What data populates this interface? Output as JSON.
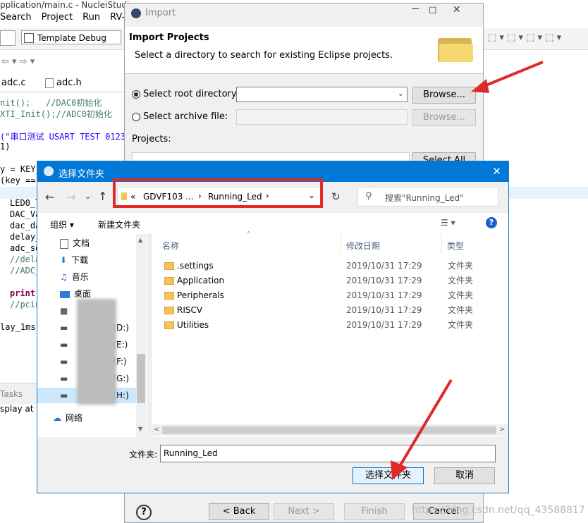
{
  "ide": {
    "title": "pplication/main.c - NucleiStudio",
    "menu": [
      "Search",
      "Project",
      "Run",
      "RV-T"
    ],
    "launch_config": "Template Debug",
    "tabs": [
      "adc.c",
      "adc.h"
    ],
    "code_lines": [
      {
        "t": "nit();   //DAC0初始化"
      },
      {
        "t": "XTI_Init();//ADC0初始化"
      },
      {
        "t": "(\"串口测试 USART TEST 01234"
      },
      {
        "t": "1)"
      },
      {
        "t": "y = KEY_"
      },
      {
        "t": "(key =="
      },
      {
        "t": "LED0_T"
      },
      {
        "t": "DAC_Va"
      },
      {
        "t": "dac_da"
      },
      {
        "t": "delay_"
      },
      {
        "t": "adc_so"
      },
      {
        "t": "//dela"
      },
      {
        "t": "//ADC_"
      },
      {
        "t": "print"
      },
      {
        "t": "//pcin"
      },
      {
        "t": "lay_1ms("
      }
    ],
    "bottom_tab": "Tasks",
    "bottom_text": "splay at th"
  },
  "import_dialog": {
    "title": "Import",
    "header_title": "Import Projects",
    "header_desc": "Select a directory to search for existing Eclipse projects.",
    "root_label": "Select root directory:",
    "archive_label": "Select archive file:",
    "browse1": "Browse...",
    "browse2": "Browse...",
    "projects_label": "Projects:",
    "select_all": "Select All",
    "back": "< Back",
    "next": "Next >",
    "finish": "Finish",
    "cancel": "Cancel"
  },
  "picker": {
    "title": "选择文件夹",
    "breadcrumb": [
      "«",
      "GDVF103 ...",
      "›",
      "Running_Led",
      "›"
    ],
    "search_placeholder": "搜索\"Running_Led\"",
    "organize": "组织 ▾",
    "new_folder": "新建文件夹",
    "columns": [
      "名称",
      "修改日期",
      "类型"
    ],
    "nav": [
      {
        "label": "文档",
        "icon": "document-icon"
      },
      {
        "label": "下载",
        "icon": "download-icon"
      },
      {
        "label": "音乐",
        "icon": "music-icon"
      },
      {
        "label": "桌面",
        "icon": "desktop-icon"
      },
      {
        "label": "",
        "icon": "drive-icon"
      },
      {
        "label": "(D:)",
        "icon": "drive-icon"
      },
      {
        "label": "(E:)",
        "icon": "drive-icon"
      },
      {
        "label": "(F:)",
        "icon": "drive-icon"
      },
      {
        "label": "(G:)",
        "icon": "drive-icon"
      },
      {
        "label": "(H:)",
        "icon": "drive-icon"
      },
      {
        "label": "网络",
        "icon": "network-icon"
      }
    ],
    "files": [
      {
        "name": ".settings",
        "date": "2019/10/31 17:29",
        "type": "文件夹"
      },
      {
        "name": "Application",
        "date": "2019/10/31 17:29",
        "type": "文件夹"
      },
      {
        "name": "Peripherals",
        "date": "2019/10/31 17:29",
        "type": "文件夹"
      },
      {
        "name": "RISCV",
        "date": "2019/10/31 17:29",
        "type": "文件夹"
      },
      {
        "name": "Utilities",
        "date": "2019/10/31 17:29",
        "type": "文件夹"
      }
    ],
    "folder_label": "文件夹:",
    "folder_value": "Running_Led",
    "select_button": "选择文件夹",
    "cancel_button": "取消"
  },
  "watermark": "https://blog.csdn.net/qq_43588817",
  "colors": {
    "accent": "#0078d7",
    "annotation": "#e02a2a"
  }
}
